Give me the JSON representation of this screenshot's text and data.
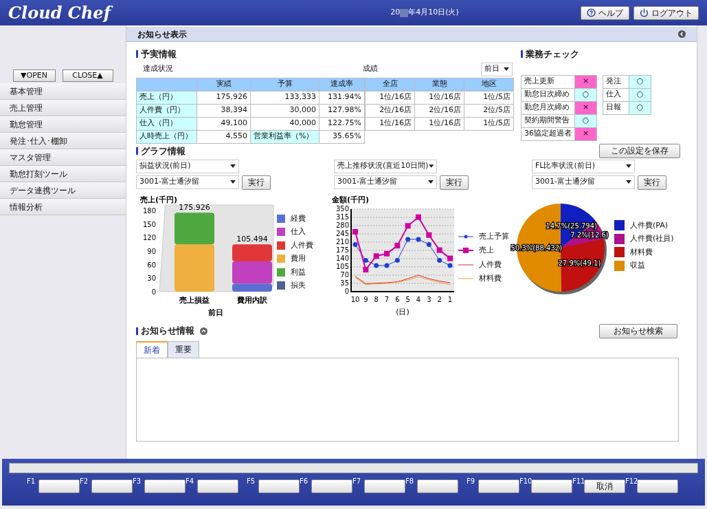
{
  "header": {
    "logo": "Cloud Chef",
    "date_prefix": "20",
    "date_rest": "年4月10日(火)",
    "buttons": [
      {
        "kind": "help",
        "label": "ヘルプ"
      },
      {
        "kind": "logout",
        "label": "ログアウト"
      }
    ]
  },
  "sidebar": {
    "open_button": "▼OPEN",
    "close_button": "CLOSE▲",
    "items": [
      {
        "label": "基本管理"
      },
      {
        "label": "売上管理"
      },
      {
        "label": "勤怠管理"
      },
      {
        "label": "発注･仕入･棚卸"
      },
      {
        "label": "マスタ管理"
      },
      {
        "label": "勤怠打刻ツール"
      },
      {
        "label": "データ連携ツール"
      },
      {
        "label": "情報分析"
      }
    ]
  },
  "page_title": "お知らせ表示",
  "budget": {
    "title": "予実情報",
    "achievement_label": "達成状況",
    "columns": [
      "",
      "実績",
      "予算",
      "達成率"
    ],
    "rows": [
      {
        "cells": [
          {
            "kind": "label",
            "text": "売上（円）"
          },
          {
            "kind": "value",
            "text": "175,926"
          },
          {
            "kind": "value",
            "text": "133,333"
          },
          {
            "kind": "value",
            "text": "131.94%"
          }
        ]
      },
      {
        "cells": [
          {
            "kind": "label",
            "text": "人件費（円）"
          },
          {
            "kind": "value",
            "text": "38,394"
          },
          {
            "kind": "value",
            "text": "30,000"
          },
          {
            "kind": "value",
            "text": "127.98%"
          }
        ]
      },
      {
        "cells": [
          {
            "kind": "label",
            "text": "仕入（円）"
          },
          {
            "kind": "value",
            "text": "49,100"
          },
          {
            "kind": "value",
            "text": "40,000"
          },
          {
            "kind": "value",
            "text": "122.75%"
          }
        ]
      },
      {
        "cells": [
          {
            "kind": "label",
            "text": "人時売上（円）"
          },
          {
            "kind": "value",
            "text": "4,550"
          },
          {
            "kind": "label",
            "text": "営業利益率（%）"
          },
          {
            "kind": "value",
            "text": "35.65%"
          }
        ]
      }
    ],
    "ranking_label": "成績",
    "period": "前日",
    "ranking_columns": [
      "全店",
      "業態",
      "地区"
    ],
    "ranking_rows": [
      [
        "1位/16店",
        "1位/16店",
        "1位/5店"
      ],
      [
        "2位/16店",
        "2位/16店",
        "2位/5店"
      ],
      [
        "1位/16店",
        "1位/16店",
        "1位/5店"
      ]
    ]
  },
  "work_check": {
    "title": "業務チェック",
    "left": [
      {
        "label": "売上更新",
        "mark": "×",
        "ok": false
      },
      {
        "label": "勤怠日次締め",
        "mark": "○",
        "ok": true
      },
      {
        "label": "勤怠月次締め",
        "mark": "×",
        "ok": false
      },
      {
        "label": "契約期間警告",
        "mark": "○",
        "ok": true
      },
      {
        "label": "36協定超過者",
        "mark": "×",
        "ok": false
      }
    ],
    "right": [
      {
        "label": "発注",
        "mark": "○",
        "ok": true
      },
      {
        "label": "仕入",
        "mark": "○",
        "ok": true
      },
      {
        "label": "日報",
        "mark": "○",
        "ok": true
      }
    ]
  },
  "graphs": {
    "title": "グラフ情報",
    "save_button": "この設定を保存",
    "panels": [
      {
        "type_select": "損益状況(前日)",
        "store_select": "3001-富士通汐留",
        "run_button": "実行"
      },
      {
        "type_select": "売上推移状況(直近10日間)",
        "store_select": "3001-富士通汐留",
        "run_button": "実行"
      },
      {
        "type_select": "FL比率状況(前日)",
        "store_select": "3001-富士通汐留",
        "run_button": "実行"
      }
    ],
    "charts": [
      {
        "chart_data": {
          "type": "bar",
          "stacked": true,
          "ylabel": "売上(千円)",
          "xlabel": "前日",
          "categories": [
            "売上損益",
            "費用内訳"
          ],
          "yticks": [
            0,
            30,
            60,
            90,
            120,
            150,
            180
          ],
          "ylim": [
            0,
            180
          ],
          "series": [
            {
              "name": "経費",
              "color": "#5a6fd0",
              "values": [
                null,
                18
              ]
            },
            {
              "name": "仕入",
              "color": "#c040c0",
              "values": [
                null,
                49
              ]
            },
            {
              "name": "人件費",
              "color": "#e03838",
              "values": [
                null,
                38
              ]
            },
            {
              "name": "費用",
              "color": "#f0b040",
              "values": [
                105,
                null
              ]
            },
            {
              "name": "利益",
              "color": "#50a840",
              "values": [
                70,
                null
              ]
            },
            {
              "name": "損失",
              "color": "#506090",
              "values": [
                null,
                null
              ]
            }
          ],
          "annotations": [
            "175.926",
            "105.494"
          ]
        }
      },
      {
        "chart_data": {
          "type": "line",
          "grid": true,
          "ylabel": "金額(千円)",
          "xlabel": "(日)",
          "categories": [
            "10",
            "9",
            "8",
            "7",
            "6",
            "5",
            "4",
            "3",
            "2",
            "1"
          ],
          "yticks": [
            0,
            35,
            70,
            105,
            140,
            175,
            210,
            245,
            280,
            315,
            350
          ],
          "ylim": [
            0,
            350
          ],
          "series": [
            {
              "name": "売上予算",
              "color": "#2040d0",
              "marker": "circle",
              "values": [
                200,
                133,
                111,
                111,
                133,
                222,
                222,
                200,
                133,
                111
              ]
            },
            {
              "name": "売上",
              "color": "#d000a0",
              "marker": "square",
              "values": [
                254,
                93,
                151,
                161,
                195,
                279,
                316,
                240,
                176,
                141
              ]
            },
            {
              "name": "人件費",
              "color": "#e03030",
              "values": [
                65,
                34,
                36,
                38,
                42,
                55,
                70,
                55,
                45,
                38
              ]
            },
            {
              "name": "材料費",
              "color": "#f0a030",
              "values": [
                60,
                30,
                33,
                35,
                40,
                50,
                62,
                50,
                40,
                30
              ]
            }
          ]
        }
      },
      {
        "chart_data": {
          "type": "pie",
          "categories": [
            "人件費(PA)",
            "人件費(社員)",
            "材料費",
            "収益"
          ],
          "values": [
            25.794,
            12.6,
            49.1,
            88.432
          ],
          "colors": [
            "#1020c0",
            "#b0108a",
            "#c01010",
            "#e08a00"
          ],
          "value_labels": [
            "14.7%(25.794)",
            "7.2%(12.6)",
            "27.9%(49.1)",
            "50.3%(88.432)"
          ]
        }
      }
    ]
  },
  "notices": {
    "title": "お知らせ情報",
    "search_button": "お知らせ検索",
    "tabs": [
      {
        "label": "新着",
        "selected": true
      },
      {
        "label": "重要",
        "selected": false
      }
    ]
  },
  "footer": {
    "keys": [
      {
        "key": "F1"
      },
      {
        "key": "F2"
      },
      {
        "key": "F3"
      },
      {
        "key": "F4"
      },
      {
        "key": "F5"
      },
      {
        "key": "F6"
      },
      {
        "key": "F7"
      },
      {
        "key": "F8"
      },
      {
        "key": "F9"
      },
      {
        "key": "F10"
      },
      {
        "key": "F11",
        "label": "取消"
      },
      {
        "key": "F12"
      }
    ]
  }
}
